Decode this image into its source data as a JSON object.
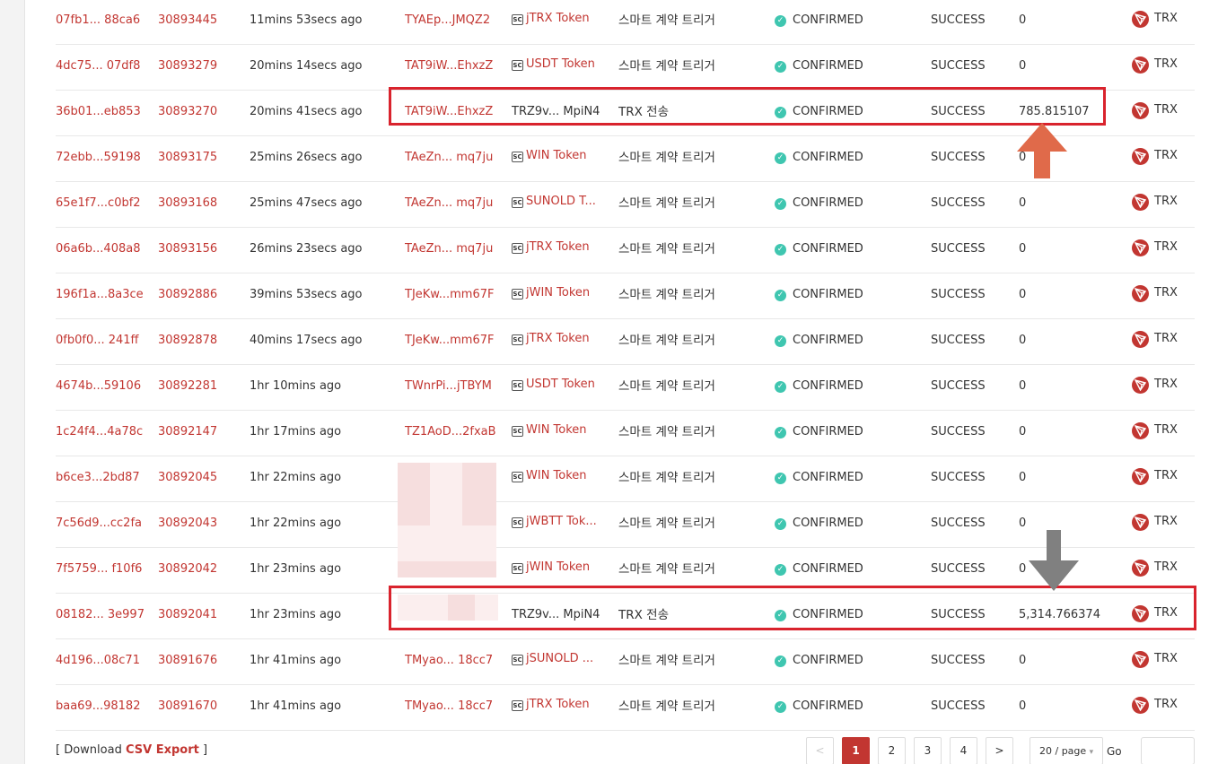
{
  "rows": [
    {
      "hash": "07fb1... 88ca6",
      "block": "30893445",
      "age": "11mins 53secs ago",
      "from": "TYAEp...JMQZ2",
      "to": "jTRX Token",
      "type": "스마트 계약 트리거",
      "status": "CONFIRMED",
      "result": "SUCCESS",
      "amount": "0",
      "token": "TRX"
    },
    {
      "hash": "4dc75... 07df8",
      "block": "30893279",
      "age": "20mins 14secs ago",
      "from": "TAT9iW...EhxzZ",
      "to": "USDT Token",
      "type": "스마트 계약 트리거",
      "status": "CONFIRMED",
      "result": "SUCCESS",
      "amount": "0",
      "token": "TRX"
    },
    {
      "hash": "36b01...eb853",
      "block": "30893270",
      "age": "20mins 41secs ago",
      "from": "TAT9iW...EhxzZ",
      "to": "TRZ9v... MpiN4",
      "type": "TRX 전송",
      "status": "CONFIRMED",
      "result": "SUCCESS",
      "amount": "785.815107",
      "token": "TRX"
    },
    {
      "hash": "72ebb...59198",
      "block": "30893175",
      "age": "25mins 26secs ago",
      "from": "TAeZn... mq7ju",
      "to": "WIN Token",
      "type": "스마트 계약 트리거",
      "status": "CONFIRMED",
      "result": "SUCCESS",
      "amount": "0",
      "token": "TRX"
    },
    {
      "hash": "65e1f7...c0bf2",
      "block": "30893168",
      "age": "25mins 47secs ago",
      "from": "TAeZn... mq7ju",
      "to": "SUNOLD T...",
      "type": "스마트 계약 트리거",
      "status": "CONFIRMED",
      "result": "SUCCESS",
      "amount": "0",
      "token": "TRX"
    },
    {
      "hash": "06a6b...408a8",
      "block": "30893156",
      "age": "26mins 23secs ago",
      "from": "TAeZn... mq7ju",
      "to": "jTRX Token",
      "type": "스마트 계약 트리거",
      "status": "CONFIRMED",
      "result": "SUCCESS",
      "amount": "0",
      "token": "TRX"
    },
    {
      "hash": "196f1a...8a3ce",
      "block": "30892886",
      "age": "39mins 53secs ago",
      "from": "TJeKw...mm67F",
      "to": "jWIN Token",
      "type": "스마트 계약 트리거",
      "status": "CONFIRMED",
      "result": "SUCCESS",
      "amount": "0",
      "token": "TRX"
    },
    {
      "hash": "0fb0f0... 241ff",
      "block": "30892878",
      "age": "40mins 17secs ago",
      "from": "TJeKw...mm67F",
      "to": "jTRX Token",
      "type": "스마트 계약 트리거",
      "status": "CONFIRMED",
      "result": "SUCCESS",
      "amount": "0",
      "token": "TRX"
    },
    {
      "hash": "4674b...59106",
      "block": "30892281",
      "age": "1hr 10mins ago",
      "from": "TWnrPi...jTBYM",
      "to": "USDT Token",
      "type": "스마트 계약 트리거",
      "status": "CONFIRMED",
      "result": "SUCCESS",
      "amount": "0",
      "token": "TRX"
    },
    {
      "hash": "1c24f4...4a78c",
      "block": "30892147",
      "age": "1hr 17mins ago",
      "from": "TZ1AoD...2fxaB",
      "to": "WIN Token",
      "type": "스마트 계약 트리거",
      "status": "CONFIRMED",
      "result": "SUCCESS",
      "amount": "0",
      "token": "TRX"
    },
    {
      "hash": "b6ce3...2bd87",
      "block": "30892045",
      "age": "1hr 22mins ago",
      "from": "",
      "to": "WIN Token",
      "type": "스마트 계약 트리거",
      "status": "CONFIRMED",
      "result": "SUCCESS",
      "amount": "0",
      "token": "TRX"
    },
    {
      "hash": "7c56d9...cc2fa",
      "block": "30892043",
      "age": "1hr 22mins ago",
      "from": "",
      "to": "jWBTT Tok...",
      "type": "스마트 계약 트리거",
      "status": "CONFIRMED",
      "result": "SUCCESS",
      "amount": "0",
      "token": "TRX"
    },
    {
      "hash": "7f5759... f10f6",
      "block": "30892042",
      "age": "1hr 23mins ago",
      "from": "",
      "to": "jWIN Token",
      "type": "스마트 계약 트리거",
      "status": "CONFIRMED",
      "result": "SUCCESS",
      "amount": "0",
      "token": "TRX"
    },
    {
      "hash": "08182... 3e997",
      "block": "30892041",
      "age": "1hr 23mins ago",
      "from": "",
      "to": "TRZ9v... MpiN4",
      "type": "TRX 전송",
      "status": "CONFIRMED",
      "result": "SUCCESS",
      "amount": "5,314.766374",
      "token": "TRX"
    },
    {
      "hash": "4d196...08c71",
      "block": "30891676",
      "age": "1hr 41mins ago",
      "from": "TMyao... 18cc7",
      "to": "jSUNOLD ...",
      "type": "스마트 계약 트리거",
      "status": "CONFIRMED",
      "result": "SUCCESS",
      "amount": "0",
      "token": "TRX"
    },
    {
      "hash": "baa69...98182",
      "block": "30891670",
      "age": "1hr 41mins ago",
      "from": "TMyao... 18cc7",
      "to": "jTRX Token",
      "type": "스마트 계약 트리거",
      "status": "CONFIRMED",
      "result": "SUCCESS",
      "amount": "0",
      "token": "TRX"
    }
  ],
  "footer": {
    "download_prefix": "[ Download ",
    "csv_label": "CSV Export",
    "download_suffix": " ]"
  },
  "pagination": {
    "prev": "<",
    "pages": [
      "1",
      "2",
      "3",
      "4"
    ],
    "next": ">",
    "page_size": "20 / page",
    "goto_label": "Go to"
  },
  "colors": {
    "link": "#c23631",
    "highlight_box": "#d9232d",
    "arrow_up": "#e06a4a",
    "arrow_down": "#808080",
    "status_check": "#3fc6b0"
  }
}
